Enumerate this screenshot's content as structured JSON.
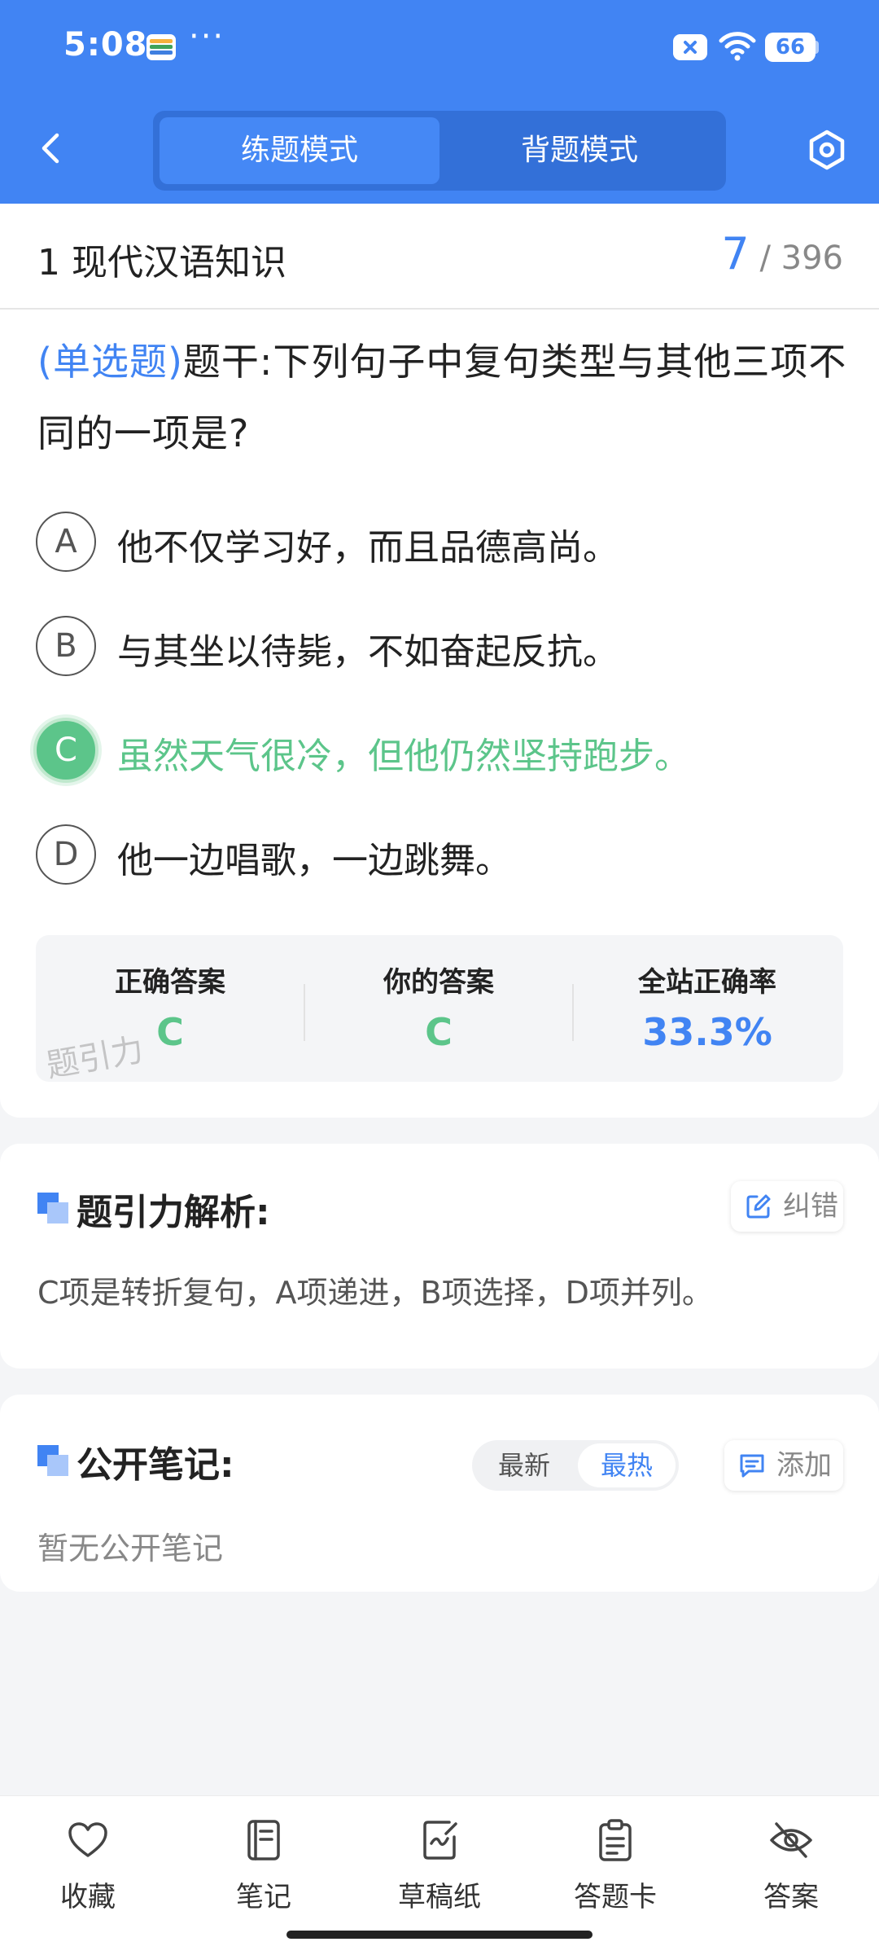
{
  "status_bar": {
    "time": "5:08",
    "more": "···",
    "battery": "66"
  },
  "header": {
    "tabs": [
      {
        "label": "练题模式"
      },
      {
        "label": "背题模式"
      }
    ]
  },
  "question": {
    "chapter": "1 现代汉语知识",
    "current": "7",
    "total": "/ 396",
    "type_label": "(单选题)",
    "stem": "题干:下列句子中复句类型与其他三项不同的一项是?",
    "options": [
      {
        "letter": "A",
        "text": "他不仅学习好，而且品德高尚。"
      },
      {
        "letter": "B",
        "text": "与其坐以待毙，不如奋起反抗。"
      },
      {
        "letter": "C",
        "text": "虽然天气很冷，但他仍然坚持跑步。",
        "selected": true
      },
      {
        "letter": "D",
        "text": "他一边唱歌，一边跳舞。"
      }
    ]
  },
  "stats": {
    "correct_label": "正确答案",
    "correct_value": "C",
    "yours_label": "你的答案",
    "yours_value": "C",
    "rate_label": "全站正确率",
    "rate_value": "33.3%",
    "watermark": "题引力"
  },
  "analysis": {
    "title": "题引力解析:",
    "report_button": "纠错",
    "text": "C项是转折复句，A项递进，B项选择，D项并列。"
  },
  "notes": {
    "title": "公开笔记:",
    "sort_latest": "最新",
    "sort_hot": "最热",
    "add_button": "添加",
    "empty": "暂无公开笔记"
  },
  "bottom_nav": [
    {
      "label": "收藏"
    },
    {
      "label": "笔记"
    },
    {
      "label": "草稿纸"
    },
    {
      "label": "答题卡"
    },
    {
      "label": "答案"
    }
  ],
  "colors": {
    "primary": "#4184f3",
    "correct": "#5cc58a"
  }
}
